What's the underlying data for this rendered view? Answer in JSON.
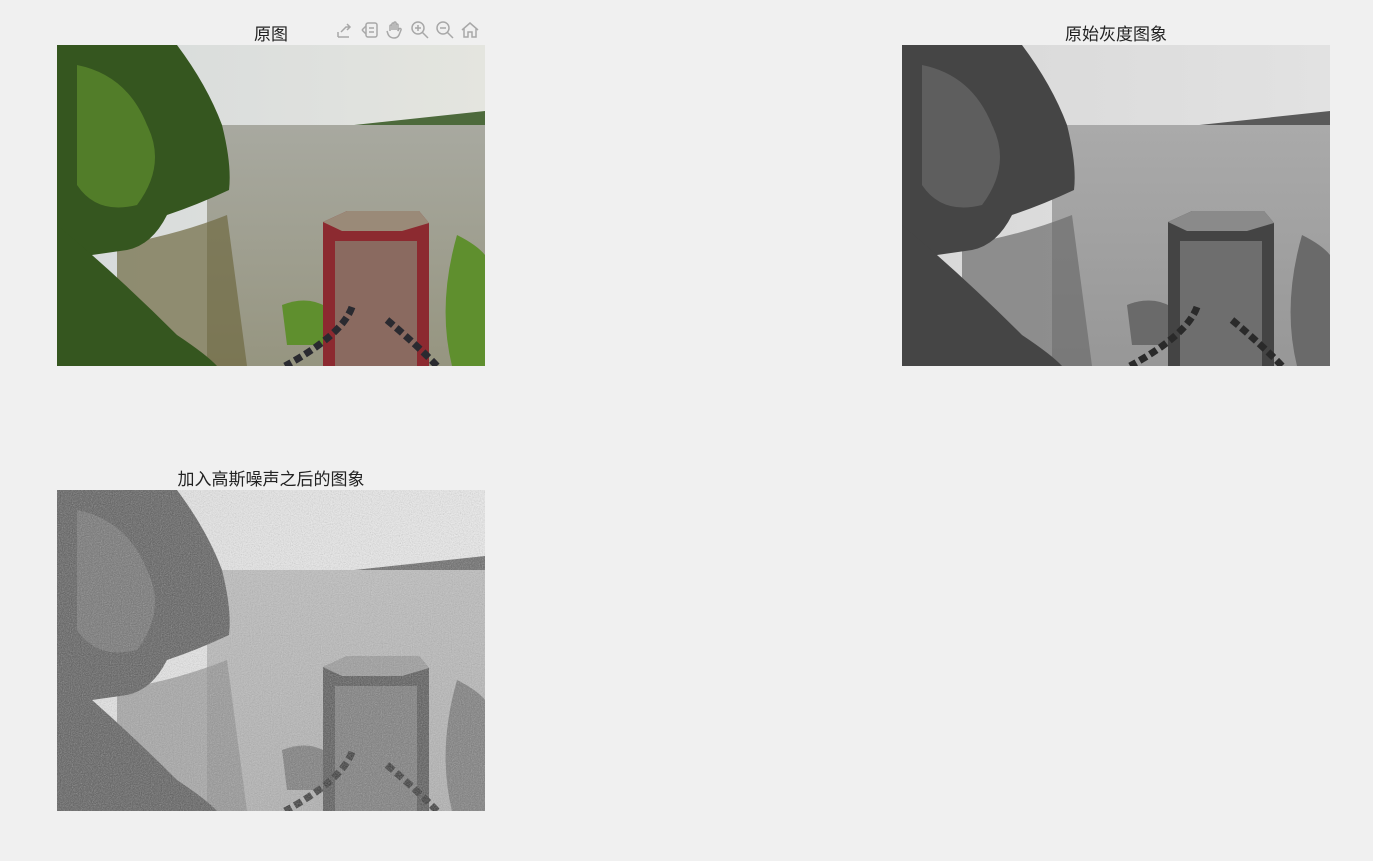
{
  "axes": [
    {
      "title": "原图",
      "image": "color river scene with red post"
    },
    {
      "title": "原始灰度图象",
      "image": "grayscale river scene"
    },
    {
      "title": "加入高斯噪声之后的图象",
      "image": "grayscale river scene with gaussian noise"
    }
  ],
  "toolbar": {
    "icons": [
      "export-icon",
      "brush-data-icon",
      "pan-hand-icon",
      "zoom-in-icon",
      "zoom-out-icon",
      "home-icon"
    ]
  }
}
